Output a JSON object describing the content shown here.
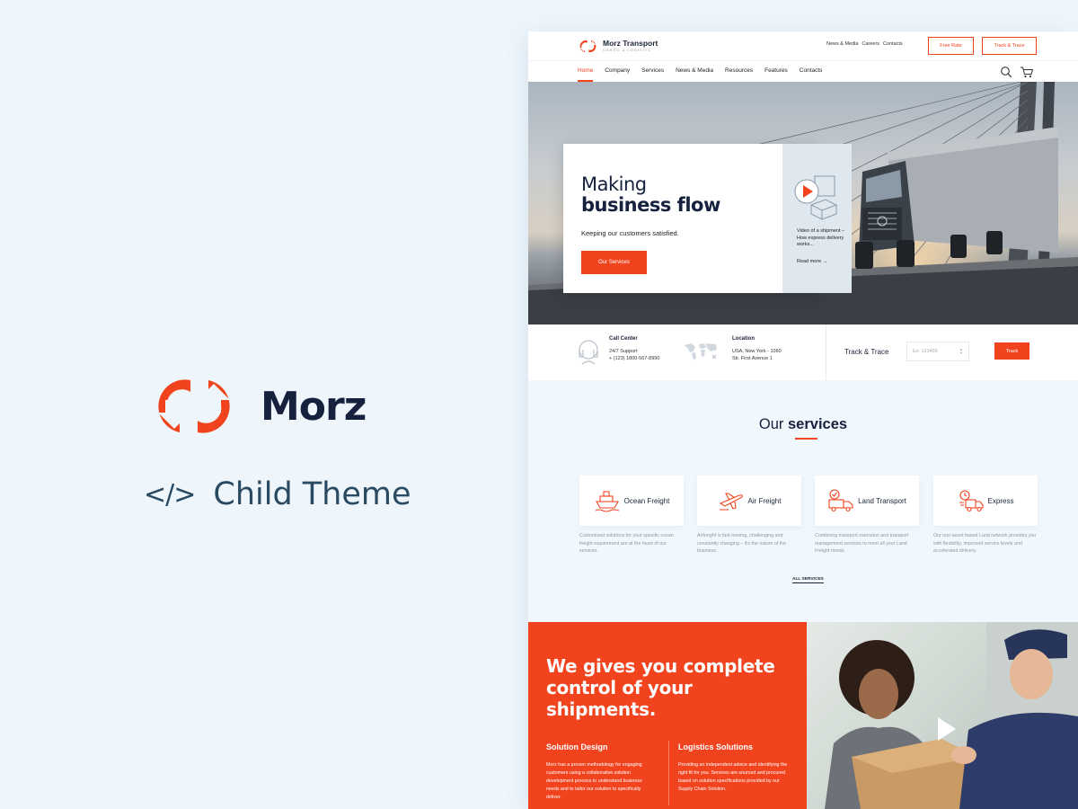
{
  "brand": {
    "name": "Morz",
    "subtitle": "Child Theme",
    "code_glyph": "</>",
    "accent": "#f2431f"
  },
  "site": {
    "logo": {
      "title": "Morz Transport",
      "subtitle": "CARGO & LOGISTIC"
    },
    "top_links": [
      "News & Media",
      "Careers",
      "Contacts"
    ],
    "buttons": {
      "free_rate": "Free Rate",
      "track_trace": "Track & Trace"
    },
    "nav": [
      "Home",
      "Company",
      "Services",
      "News & Media",
      "Resources",
      "Features",
      "Contacts"
    ],
    "active_nav": "Home",
    "hero": {
      "title_line1": "Making",
      "title_line2": "business flow",
      "subtitle": "Keeping our customers satisfied.",
      "cta": "Our Services",
      "video_text": "Video of a shipment – How express delivery works...",
      "read_more": "Read more →"
    },
    "info": {
      "call": {
        "title": "Call Center",
        "line1": "24/7 Support",
        "line2": "+ (123) 1800-567-8990"
      },
      "location": {
        "title": "Location",
        "line1": "USA, New York - 1060",
        "line2": "Str. First Avenue 1"
      },
      "track": {
        "label": "Track & Trace",
        "placeholder": "Ex: 123456",
        "button": "Track"
      }
    },
    "services": {
      "heading_plain": "Our ",
      "heading_bold": "services",
      "items": [
        {
          "name": "Ocean Freight",
          "icon": "ship-icon",
          "desc": "Customized solutions for your specific ocean freight requirement are at the heart of our services."
        },
        {
          "name": "Air Freight",
          "icon": "plane-icon",
          "desc": "Airfreight is fast-moving, challenging and constantly changing – it's the nature of the business."
        },
        {
          "name": "Land Transport",
          "icon": "truck-icon",
          "desc": "Combining transport execution and transport management services to meet all your Land Freight needs."
        },
        {
          "name": "Express",
          "icon": "express-truck-icon",
          "desc": "Our non-asset based Land network provides you with flexibility, improved service levels and accelerated delivery."
        }
      ],
      "all_link": "ALL SERVICES"
    },
    "control": {
      "title": "We gives you complete control of your shipments.",
      "col1": {
        "title": "Solution Design",
        "text": "Morz has a proven methodology for engaging customers using a collaborative solution development process to understand business needs and to tailor our solution to specifically deliver."
      },
      "col2": {
        "title": "Logistics Solutions",
        "text": "Providing an independent advice and identifying the right fit for you. Services are sourced and procured based on solution specifications provided by our Supply Chain Solution."
      }
    }
  }
}
